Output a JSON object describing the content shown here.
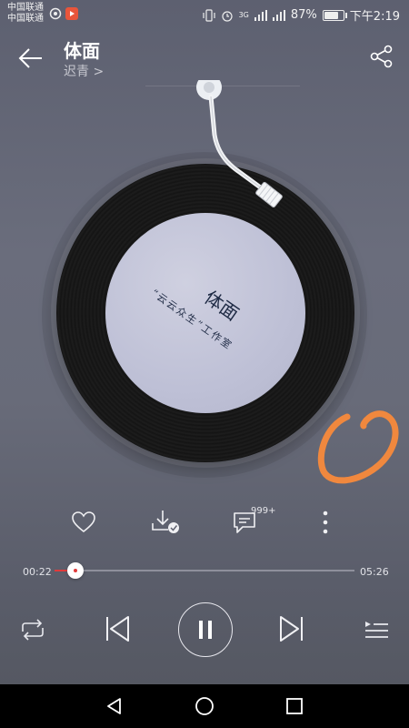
{
  "status_bar": {
    "carrier_1": "中国联通",
    "carrier_2": "中国联通",
    "network": "3G",
    "battery": "87%",
    "battery_level": 0.87,
    "time": "下午2:19"
  },
  "header": {
    "song_title": "体面",
    "artist": "迟青 >"
  },
  "record_label": {
    "title": "体面",
    "subtitle": "“云云众生”工作室"
  },
  "actions": {
    "comment_count": "999+"
  },
  "playback": {
    "elapsed": "00:22",
    "duration": "05:26",
    "progress": 0.07
  },
  "icons": {
    "back": "back-arrow-icon",
    "share": "share-icon",
    "like": "heart-icon",
    "download": "download-icon",
    "comment": "comment-icon",
    "more": "more-icon",
    "repeat": "repeat-icon",
    "prev": "previous-icon",
    "pause": "pause-icon",
    "next": "next-icon",
    "playlist": "playlist-icon"
  },
  "colors": {
    "accent": "#e03b3b",
    "annotation": "#f0883e"
  }
}
